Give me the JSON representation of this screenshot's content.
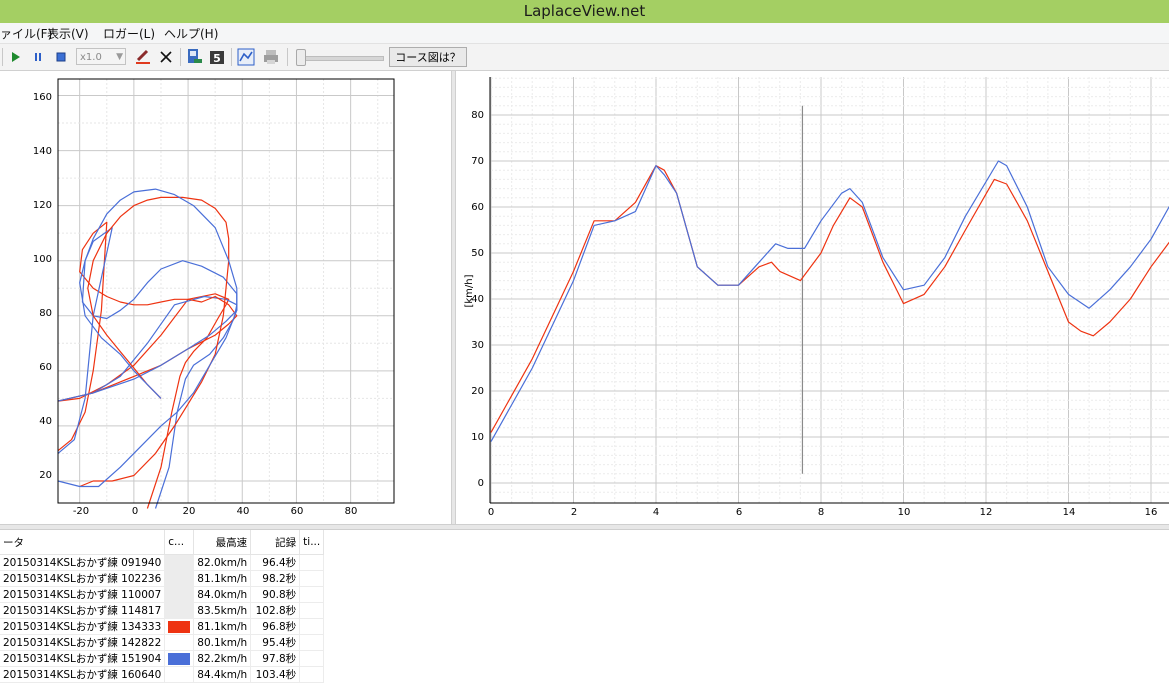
{
  "window": {
    "title": "LaplaceView.net"
  },
  "menu": [
    "ァイル(F)",
    "表示(V)",
    "ロガー(L)",
    "ヘルプ(H)"
  ],
  "toolbar": {
    "zoom_value": "x1.0",
    "course_button_label": "コース図は？"
  },
  "icons": [
    "play-icon",
    "pause-icon",
    "stop-icon",
    "pen-icon",
    "close-icon",
    "export-icon",
    "number-icon",
    "chart-icon",
    "print-icon"
  ],
  "colors": {
    "red": "#ee3311",
    "blue": "#4a6fd8",
    "title_bar": "#a4cf63"
  },
  "course_map": {
    "x_ticks": [
      "-20",
      "0",
      "20",
      "40",
      "60",
      "80"
    ],
    "y_ticks": [
      "160",
      "140",
      "120",
      "100",
      "80",
      "60",
      "40",
      "20"
    ]
  },
  "speed_chart": {
    "y_label": "[km/h]",
    "x_ticks": [
      "0",
      "2",
      "4",
      "6",
      "8",
      "10",
      "12",
      "14",
      "16"
    ],
    "y_ticks": [
      "80",
      "70",
      "60",
      "50",
      "40",
      "30",
      "20",
      "10",
      "0"
    ]
  },
  "chart_data": [
    {
      "type": "line",
      "title": "",
      "xlabel": "",
      "ylabel": "",
      "xlim": [
        -28,
        96
      ],
      "ylim": [
        12,
        166
      ],
      "grid": true,
      "series": [
        {
          "color": "#ee3311",
          "x": [
            5,
            10,
            14,
            17,
            19,
            22,
            27,
            31,
            34,
            35,
            30,
            20,
            10,
            0,
            -10,
            -20,
            -28
          ],
          "y": [
            10,
            25,
            45,
            58,
            63,
            67,
            72,
            79,
            84,
            86,
            88,
            86,
            73,
            62,
            55,
            50,
            49
          ]
        },
        {
          "color": "#4a6fd8",
          "x": [
            8,
            13,
            16,
            19,
            22,
            28,
            33,
            37,
            38,
            34,
            26,
            15,
            5,
            -5,
            -15,
            -28
          ],
          "y": [
            10,
            25,
            45,
            57,
            62,
            66,
            72,
            79,
            84,
            86,
            87,
            84,
            70,
            58,
            52,
            49
          ]
        },
        {
          "color": "#ee3311",
          "x": [
            -28,
            -15,
            0,
            10,
            20,
            30,
            35,
            38,
            35,
            30,
            25,
            20,
            15,
            10,
            5,
            0,
            -5,
            -10,
            -15,
            -20,
            -19,
            -15,
            -10,
            -12,
            -15,
            -18,
            -23,
            -28
          ],
          "y": [
            49,
            52,
            58,
            62,
            68,
            73,
            77,
            80,
            84,
            87,
            85,
            86,
            86,
            85,
            84,
            84,
            85,
            87,
            90,
            96,
            104,
            110,
            114,
            82,
            60,
            45,
            35,
            31
          ]
        },
        {
          "color": "#4a6fd8",
          "x": [
            -28,
            -15,
            0,
            10,
            20,
            28,
            34,
            38,
            38,
            33,
            25,
            18,
            10,
            5,
            0,
            -5,
            -10,
            -15,
            -19,
            -18,
            -15,
            -8,
            -15,
            -18,
            -22,
            -28
          ],
          "y": [
            49,
            52,
            57,
            62,
            68,
            73,
            78,
            82,
            88,
            94,
            98,
            100,
            97,
            92,
            86,
            82,
            79,
            80,
            85,
            100,
            107,
            112,
            80,
            50,
            35,
            30
          ]
        },
        {
          "color": "#ee3311",
          "x": [
            -20,
            -15,
            -8,
            0,
            8,
            15,
            20,
            25,
            30,
            33,
            34,
            35,
            35,
            34,
            30,
            25,
            18,
            10,
            5,
            0,
            -5,
            -10,
            -15,
            -17,
            -15,
            -10,
            -5,
            0,
            5,
            10
          ],
          "y": [
            18,
            20,
            20,
            22,
            30,
            40,
            48,
            56,
            66,
            80,
            90,
            100,
            108,
            114,
            119,
            122,
            123,
            123,
            122,
            120,
            116,
            110,
            100,
            90,
            80,
            73,
            67,
            61,
            55,
            50
          ]
        },
        {
          "color": "#4a6fd8",
          "x": [
            -28,
            -20,
            -13,
            -5,
            3,
            10,
            16,
            22,
            28,
            34,
            38,
            38,
            35,
            30,
            22,
            15,
            8,
            0,
            -5,
            -10,
            -15,
            -18,
            -20,
            -18,
            -12,
            -5,
            0,
            5,
            10
          ],
          "y": [
            20,
            18,
            18,
            25,
            33,
            40,
            45,
            52,
            62,
            72,
            82,
            90,
            100,
            112,
            120,
            124,
            126,
            125,
            122,
            117,
            108,
            100,
            92,
            80,
            72,
            66,
            60,
            55,
            50
          ]
        }
      ]
    },
    {
      "type": "line",
      "title": "",
      "xlabel": "",
      "ylabel": "[km/h]",
      "xlim": [
        0,
        16.5
      ],
      "ylim": [
        -3,
        89
      ],
      "grid": true,
      "cursor_x": 7.55,
      "series": [
        {
          "color": "#ee3311",
          "x": [
            0,
            1,
            2,
            2.5,
            3,
            3.5,
            4,
            4.2,
            4.5,
            5,
            5.5,
            6,
            6.5,
            6.8,
            7,
            7.5,
            8,
            8.3,
            8.7,
            9,
            9.5,
            10,
            10.5,
            11,
            11.5,
            12.2,
            12.5,
            13,
            13.5,
            14,
            14.3,
            14.6,
            15,
            15.5,
            16,
            16.5
          ],
          "y": [
            11,
            27,
            46,
            57,
            57,
            61,
            69,
            68,
            63,
            47,
            43,
            43,
            47,
            48,
            46,
            44,
            50,
            56,
            62,
            60,
            48,
            39,
            41,
            47,
            55,
            66,
            65,
            57,
            46,
            35,
            33,
            32,
            35,
            40,
            47,
            53
          ]
        },
        {
          "color": "#4a6fd8",
          "x": [
            0,
            1,
            2,
            2.5,
            3,
            3.5,
            4,
            4.2,
            4.5,
            5,
            5.5,
            6,
            6.5,
            6.9,
            7.2,
            7.6,
            8,
            8.5,
            8.7,
            9,
            9.5,
            10,
            10.5,
            11,
            11.5,
            12.3,
            12.5,
            13,
            13.5,
            14,
            14.5,
            15,
            15.5,
            16,
            16.5
          ],
          "y": [
            9,
            25,
            44,
            56,
            57,
            59,
            69,
            67,
            63,
            47,
            43,
            43,
            48,
            52,
            51,
            51,
            57,
            63,
            64,
            61,
            49,
            42,
            43,
            49,
            58,
            70,
            69,
            60,
            47,
            41,
            38,
            42,
            47,
            53,
            61
          ]
        }
      ]
    }
  ],
  "data_table": {
    "headers": [
      "ータ",
      "c...",
      "最高速",
      "記録",
      "ti..."
    ],
    "rows": [
      {
        "name": "20150314KSLおかず練 091940",
        "color": "",
        "max_speed": "82.0km/h",
        "record": "96.4秒"
      },
      {
        "name": "20150314KSLおかず練 102236",
        "color": "",
        "max_speed": "81.1km/h",
        "record": "98.2秒"
      },
      {
        "name": "20150314KSLおかず練 110007",
        "color": "",
        "max_speed": "84.0km/h",
        "record": "90.8秒"
      },
      {
        "name": "20150314KSLおかず練 114817",
        "color": "",
        "max_speed": "83.5km/h",
        "record": "102.8秒"
      },
      {
        "name": "20150314KSLおかず練 134333",
        "color": "#ee3311",
        "max_speed": "81.1km/h",
        "record": "96.8秒"
      },
      {
        "name": "20150314KSLおかず練 142822",
        "color": "",
        "max_speed": "80.1km/h",
        "record": "95.4秒"
      },
      {
        "name": "20150314KSLおかず練 151904",
        "color": "#4a6fd8",
        "max_speed": "82.2km/h",
        "record": "97.8秒"
      },
      {
        "name": "20150314KSLおかず練 160640",
        "color": "",
        "max_speed": "84.4km/h",
        "record": "103.4秒"
      }
    ]
  }
}
